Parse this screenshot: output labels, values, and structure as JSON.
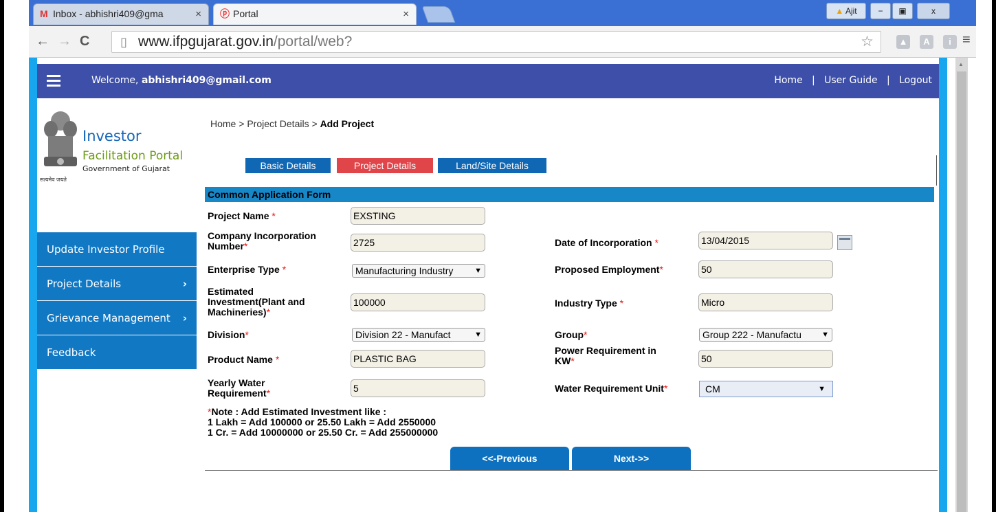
{
  "browser": {
    "tabs": [
      {
        "label": "Inbox - abhishri409@gma",
        "icon": "gmail-icon"
      },
      {
        "label": "Portal",
        "icon": "portal-icon"
      }
    ],
    "profile": "Ajit",
    "url_host": "www.ifpgujarat.gov.in",
    "url_path": "/portal/web?"
  },
  "topbar": {
    "welcome_prefix": "Welcome,",
    "user_email": "abhishri409@gmail.com",
    "links": [
      "Home",
      "User Guide",
      "Logout"
    ],
    "bg_color": "#3d4fa8"
  },
  "logo": {
    "line1": "Investor",
    "line2": "Facilitation Portal",
    "line3": "Government of Gujarat",
    "motto": "सत्यमेव जयते"
  },
  "sidebar": {
    "items": [
      {
        "label": "Update Investor Profile",
        "chevron": ""
      },
      {
        "label": "Project Details",
        "chevron": "›"
      },
      {
        "label": "Grievance Management",
        "chevron": "›"
      },
      {
        "label": "Feedback",
        "chevron": ""
      }
    ],
    "color": "#1178c4"
  },
  "breadcrumb": {
    "home": "Home",
    "sep1": ">",
    "mid": "Project Details",
    "sep2": ">",
    "current": "Add Project"
  },
  "form_tabs": [
    {
      "label": "Basic Details",
      "color": "#1067b3"
    },
    {
      "label": "Project Details",
      "color": "#e0454a"
    },
    {
      "label": "Land/Site Details",
      "color": "#1067b3"
    }
  ],
  "form": {
    "header": "Common Application Form",
    "required_mark": "*",
    "project_name": {
      "label": "Project Name",
      "value": "EXSTING"
    },
    "company_incorporation_number": {
      "label_l1": "Company Incorporation",
      "label_l2": "Number",
      "value": "2725"
    },
    "date_of_incorporation": {
      "label": "Date of Incorporation",
      "value": "13/04/2015"
    },
    "enterprise_type": {
      "label": "Enterprise Type",
      "value": "Manufacturing Industry"
    },
    "proposed_employment": {
      "label": "Proposed Employment",
      "value": "50"
    },
    "estimated_investment": {
      "label_l1": "Estimated",
      "label_l2": "Investment(Plant and",
      "label_l3": "Machineries)",
      "value": "100000"
    },
    "industry_type": {
      "label": "Industry Type",
      "value": "Micro"
    },
    "division": {
      "label": "Division",
      "value": "Division 22 - Manufact"
    },
    "group": {
      "label": "Group",
      "value": "Group 222 - Manufactu"
    },
    "product_name": {
      "label": "Product Name",
      "value": "PLASTIC BAG"
    },
    "power_requirement": {
      "label_l1": "Power Requirement in",
      "label_l2": "KW",
      "value": "50"
    },
    "yearly_water": {
      "label_l1": "Yearly Water",
      "label_l2": "Requirement",
      "value": "5"
    },
    "water_unit": {
      "label": "Water Requirement Unit",
      "value": "CM"
    },
    "note_l1": "Note : Add Estimated Investment like :",
    "note_l2": "1 Lakh = Add 100000 or 25.50 Lakh = Add 2550000",
    "note_l3": "1 Cr. = Add 10000000 or 25.50 Cr. = Add 255000000",
    "prev_button": "<<-Previous",
    "next_button": "Next->>"
  }
}
